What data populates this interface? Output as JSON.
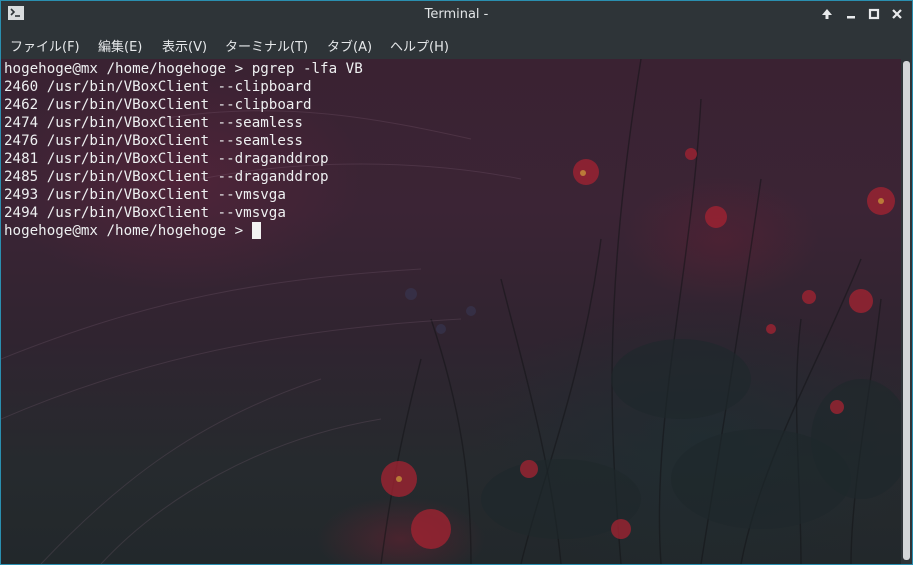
{
  "window": {
    "title": "Terminal -",
    "icon": "terminal-icon",
    "controls": [
      "arrow-up-icon",
      "minimize-icon",
      "maximize-icon",
      "close-icon"
    ]
  },
  "menu": {
    "items": [
      {
        "label": "ファイル(F)"
      },
      {
        "label": "編集(E)"
      },
      {
        "label": "表示(V)"
      },
      {
        "label": "ターミナル(T)"
      },
      {
        "label": "タブ(A)"
      },
      {
        "label": "ヘルプ(H)"
      }
    ]
  },
  "terminal": {
    "lines": [
      "hogehoge@mx /home/hogehoge > pgrep -lfa VB",
      "2460 /usr/bin/VBoxClient --clipboard",
      "2462 /usr/bin/VBoxClient --clipboard",
      "2474 /usr/bin/VBoxClient --seamless",
      "2476 /usr/bin/VBoxClient --seamless",
      "2481 /usr/bin/VBoxClient --draganddrop",
      "2485 /usr/bin/VBoxClient --draganddrop",
      "2493 /usr/bin/VBoxClient --vmsvga",
      "2494 /usr/bin/VBoxClient --vmsvga"
    ],
    "prompt": "hogehoge@mx /home/hogehoge > "
  },
  "colors": {
    "titlebar": "#2e3438",
    "border": "#2a8fb0",
    "text": "#eef0f1"
  }
}
